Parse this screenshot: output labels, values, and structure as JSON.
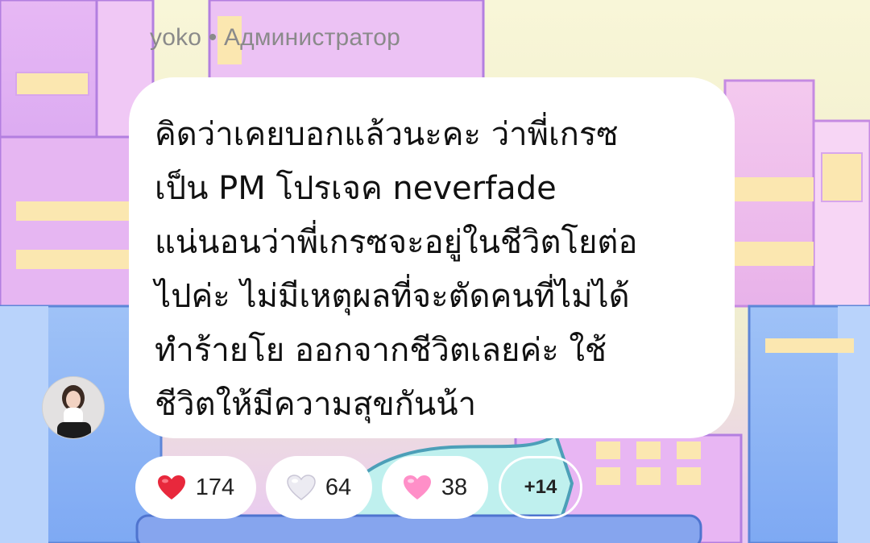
{
  "message": {
    "sender": "yoko • Администратор",
    "text_lines": [
      "คิดว่าเคยบอกแล้วนะคะ ว่าพี่เกรซ",
      "เป็น PM โปรเจค neverfade",
      "แน่นอนว่าพี่เกรซจะอยู่ในชีวิตโยต่อ",
      "ไปค่ะ ไม่มีเหตุผลที่จะตัดคนที่ไม่ได้",
      "ทำร้ายโย ออกจากชีวิตเลยค่ะ ใช้",
      "ชีวิตให้มีความสุขกันน้า"
    ]
  },
  "reactions": [
    {
      "icon": "red-heart-icon",
      "color": "#e8283c",
      "count": "174"
    },
    {
      "icon": "white-heart-icon",
      "color": "#e9e6f0",
      "count": "64"
    },
    {
      "icon": "pink-heart-icon",
      "color": "#ff8fc8",
      "count": "38"
    },
    {
      "icon": "",
      "count": "+14"
    }
  ]
}
